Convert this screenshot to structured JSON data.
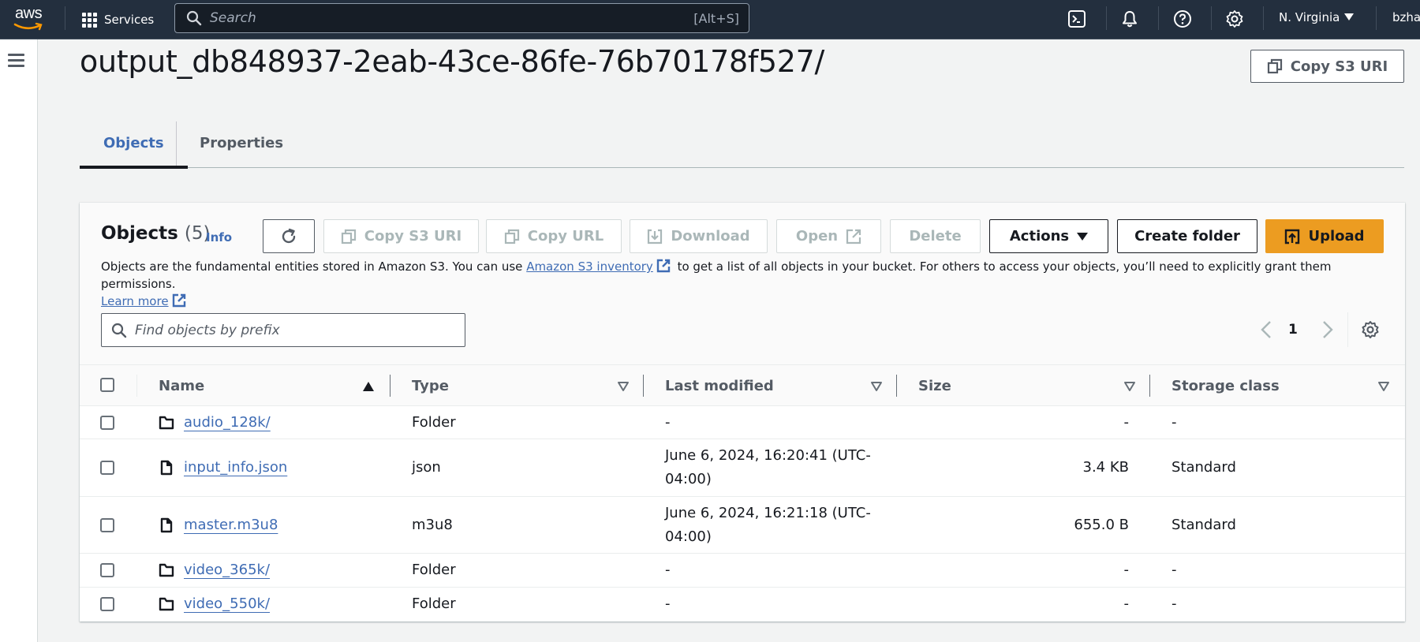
{
  "topbar": {
    "logo_text": "aws",
    "services_label": "Services",
    "search_placeholder": "Search",
    "search_shortcut": "[Alt+S]",
    "icons": [
      "cloudshell-icon",
      "bell-icon",
      "help-icon",
      "settings-icon"
    ],
    "region": "N. Virginia",
    "user": "bzha"
  },
  "page": {
    "title": "output_db848937-2eab-43ce-86fe-76b70178f527/",
    "copy_s3_uri_label": "Copy S3 URI"
  },
  "tabs": [
    {
      "label": "Objects",
      "active": true
    },
    {
      "label": "Properties",
      "active": false
    }
  ],
  "objects_panel": {
    "title": "Objects",
    "count": "(5)",
    "info_label": "Info",
    "buttons": {
      "refresh": "refresh",
      "copy_s3_uri": "Copy S3 URI",
      "copy_url": "Copy URL",
      "download": "Download",
      "open": "Open",
      "delete": "Delete",
      "actions": "Actions",
      "create_folder": "Create folder",
      "upload": "Upload"
    },
    "description_before": "Objects are the fundamental entities stored in Amazon S3. You can use ",
    "inventory_link": "Amazon S3 inventory",
    "description_after": " to get a list of all objects in your bucket. For others to access your objects, you’ll need to explicitly grant them permissions.",
    "learn_more": "Learn more",
    "search_placeholder": "Find objects by prefix",
    "page_number": "1"
  },
  "table": {
    "columns": [
      "Name",
      "Type",
      "Last modified",
      "Size",
      "Storage class"
    ],
    "sorted_column": "Name",
    "sort_direction": "ascending",
    "rows": [
      {
        "name": "audio_128k/",
        "kind": "folder",
        "type": "Folder",
        "modified_1": "-",
        "modified_2": "",
        "size": "-",
        "storage": "-"
      },
      {
        "name": "input_info.json",
        "kind": "file",
        "type": "json",
        "modified_1": "June 6, 2024, 16:20:41 (UTC-",
        "modified_2": "04:00)",
        "size": "3.4 KB",
        "storage": "Standard"
      },
      {
        "name": "master.m3u8",
        "kind": "file",
        "type": "m3u8",
        "modified_1": "June 6, 2024, 16:21:18 (UTC-",
        "modified_2": "04:00)",
        "size": "655.0 B",
        "storage": "Standard"
      },
      {
        "name": "video_365k/",
        "kind": "folder",
        "type": "Folder",
        "modified_1": "-",
        "modified_2": "",
        "size": "-",
        "storage": "-"
      },
      {
        "name": "video_550k/",
        "kind": "folder",
        "type": "Folder",
        "modified_1": "-",
        "modified_2": "",
        "size": "-",
        "storage": "-"
      }
    ]
  },
  "colors": {
    "nav_bg": "#232f3e",
    "link": "#3f6cb4",
    "primary": "#ec9c21"
  }
}
